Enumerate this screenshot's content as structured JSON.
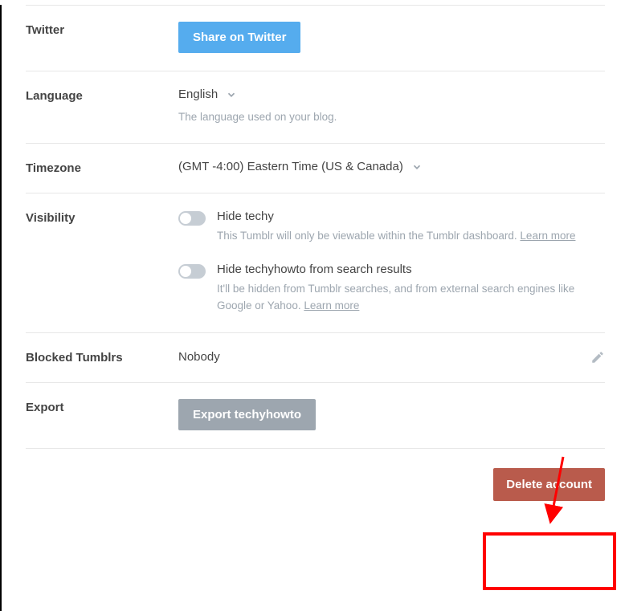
{
  "twitter": {
    "label": "Twitter",
    "button": "Share on Twitter"
  },
  "language": {
    "label": "Language",
    "value": "English",
    "hint": "The language used on your blog."
  },
  "timezone": {
    "label": "Timezone",
    "value": "(GMT -4:00) Eastern Time (US & Canada)"
  },
  "visibility": {
    "label": "Visibility",
    "options": [
      {
        "title": "Hide techy",
        "desc": "This Tumblr will only be viewable within the Tumblr dashboard. ",
        "learn": "Learn more"
      },
      {
        "title": "Hide techyhowto from search results",
        "desc": "It'll be hidden from Tumblr searches, and from external search engines like Google or Yahoo. ",
        "learn": "Learn more"
      }
    ]
  },
  "blocked": {
    "label": "Blocked Tumblrs",
    "value": "Nobody"
  },
  "export": {
    "label": "Export",
    "button": "Export techyhowto"
  },
  "delete": {
    "button": "Delete account"
  }
}
